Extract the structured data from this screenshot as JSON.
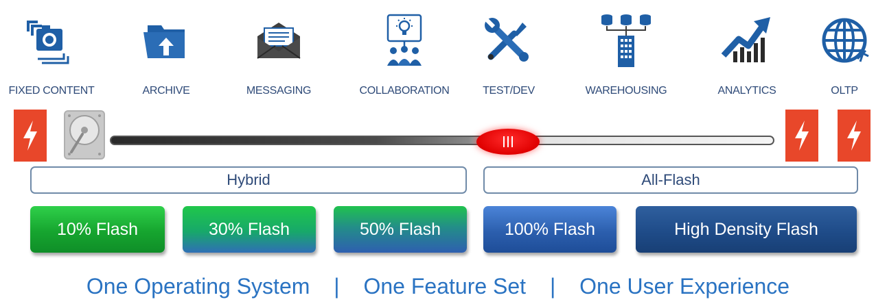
{
  "workloads": [
    {
      "label": "FIXED CONTENT",
      "icon": "photo-stack-icon"
    },
    {
      "label": "ARCHIVE",
      "icon": "archive-folder-icon"
    },
    {
      "label": "MESSAGING",
      "icon": "envelope-icon"
    },
    {
      "label": "COLLABORATION",
      "icon": "idea-team-icon"
    },
    {
      "label": "TEST/DEV",
      "icon": "wrench-screwdriver-icon"
    },
    {
      "label": "WAREHOUSING",
      "icon": "database-building-icon"
    },
    {
      "label": "ANALYTICS",
      "icon": "trend-chart-icon"
    },
    {
      "label": "OLTP",
      "icon": "globe-icon"
    }
  ],
  "slider": {
    "left_icons": [
      "flash-icon",
      "hard-disk-icon"
    ],
    "right_icons": [
      "flash-icon",
      "flash-icon"
    ],
    "position": 0.6
  },
  "categories": {
    "hybrid": "Hybrid",
    "all_flash": "All-Flash"
  },
  "options": [
    {
      "label": "10% Flash"
    },
    {
      "label": "30% Flash"
    },
    {
      "label": "50% Flash"
    },
    {
      "label": "100% Flash"
    },
    {
      "label": "High Density Flash"
    }
  ],
  "tagline": {
    "part1": "One Operating System",
    "separator": "|",
    "part2": "One Feature Set",
    "part3": "One User Experience"
  },
  "colors": {
    "icon_blue": "#1f5fa6",
    "flash_orange": "#e8472a",
    "thumb_red": "#e00000",
    "tagline_blue": "#2a73c2"
  }
}
